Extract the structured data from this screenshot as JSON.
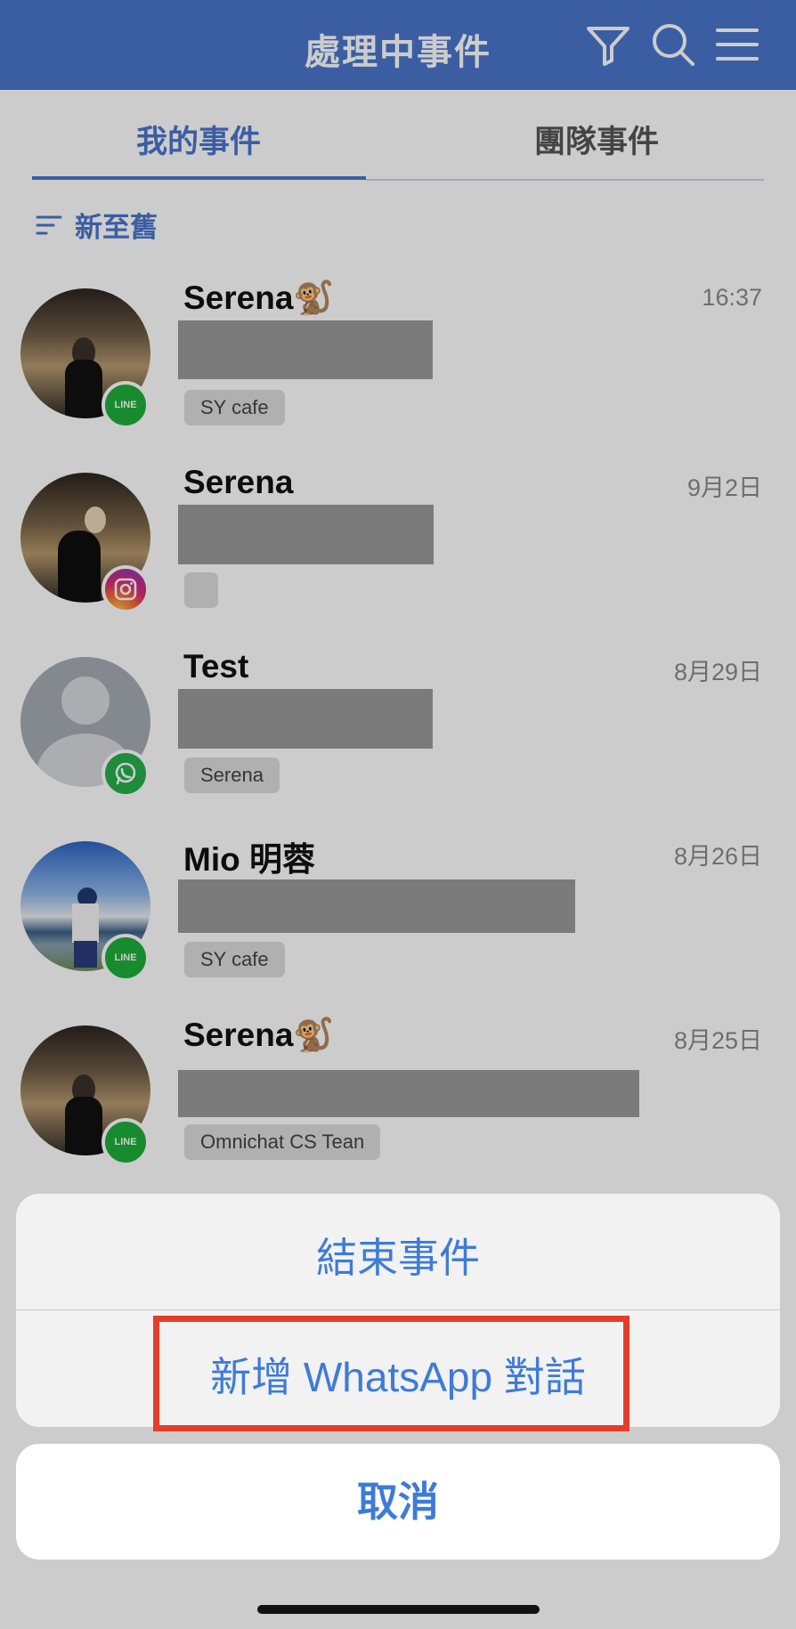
{
  "header": {
    "title": "處理中事件",
    "icons": [
      "filter-icon",
      "search-icon",
      "menu-icon"
    ]
  },
  "tabs": [
    {
      "label": "我的事件",
      "active": true
    },
    {
      "label": "團隊事件",
      "active": false
    }
  ],
  "sort": {
    "label": "新至舊"
  },
  "conversations": [
    {
      "name": "Serena🐒",
      "time": "16:37",
      "channel": "LINE",
      "tag": "SY cafe"
    },
    {
      "name": "Serena",
      "time": "9月2日",
      "channel": "Instagram",
      "tag": ""
    },
    {
      "name": "Test",
      "time": "8月29日",
      "channel": "WhatsApp",
      "tag": "Serena"
    },
    {
      "name": "Mio 明蓉",
      "time": "8月26日",
      "channel": "LINE",
      "tag": "SY cafe"
    },
    {
      "name": "Serena🐒",
      "time": "8月25日",
      "channel": "LINE",
      "tag": "Omnichat CS Tean"
    }
  ],
  "action_sheet": {
    "end_event_label": "結束事件",
    "new_whatsapp_label": "新增 WhatsApp 對話",
    "cancel_label": "取消"
  },
  "colors": {
    "brand": "#4a76cc",
    "action": "#3e7bd8",
    "highlight": "#e53d2a",
    "line": "#1fae3a",
    "whatsapp": "#25b04c"
  }
}
